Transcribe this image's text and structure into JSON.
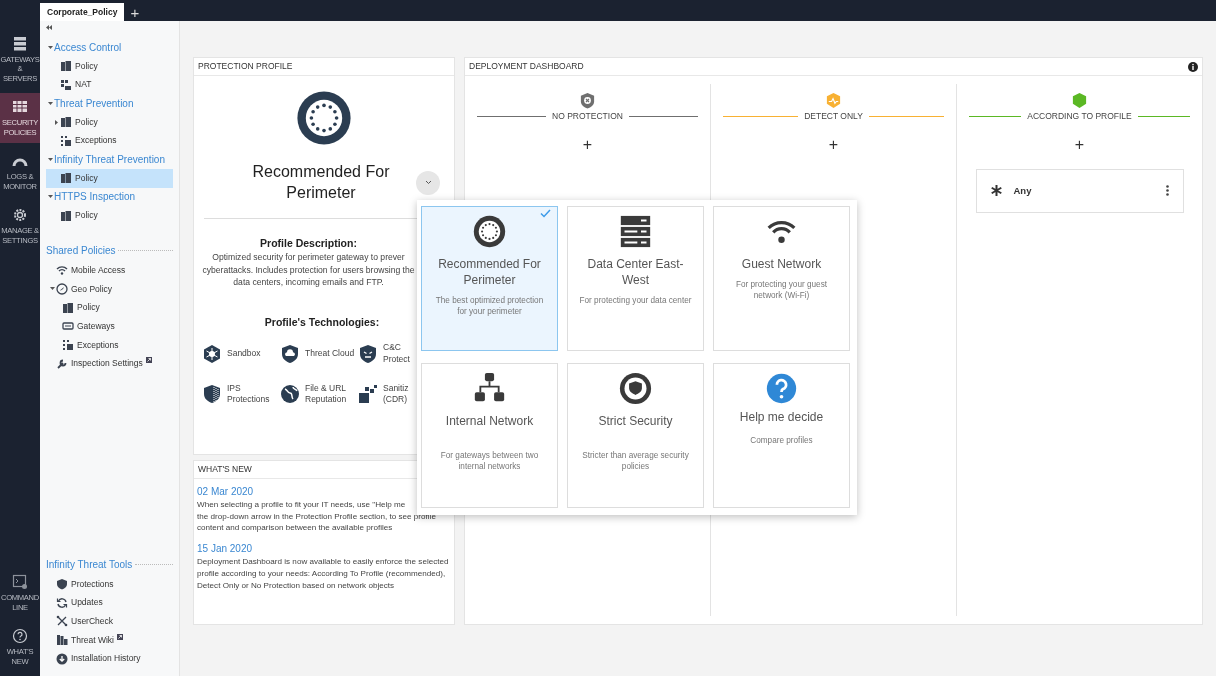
{
  "tabs": [
    {
      "label": "Corporate_Policy",
      "selected": true
    }
  ],
  "new_tab_button": "+",
  "nav": {
    "main": [
      {
        "label": "GATEWAYS & SERVERS",
        "kind": "gateways",
        "selected": false
      },
      {
        "label": "SECURITY POLICIES",
        "kind": "policies",
        "selected": true
      },
      {
        "label": "LOGS & MONITOR",
        "kind": "logs",
        "selected": false
      },
      {
        "label": "MANAGE & SETTINGS",
        "kind": "manage",
        "selected": false
      }
    ],
    "bottom": [
      {
        "label": "COMMAND LINE",
        "kind": "command",
        "selected": false
      },
      {
        "label": "WHAT'S NEW",
        "kind": "whatsnew",
        "selected": false
      }
    ]
  },
  "tree": {
    "sections": [
      {
        "title": "Access Control",
        "expanded": true,
        "children": [
          {
            "label": "Policy",
            "kind": "policy",
            "selected": false
          },
          {
            "label": "NAT",
            "kind": "nat",
            "selected": false
          }
        ]
      },
      {
        "title": "Threat Prevention",
        "expanded": true,
        "children": [
          {
            "label": "Policy",
            "kind": "policy",
            "selected": false,
            "expanded": false
          },
          {
            "label": "Exceptions",
            "kind": "exceptions",
            "selected": false
          }
        ]
      },
      {
        "title": "Infinity Threat Prevention",
        "expanded": true,
        "children": [
          {
            "label": "Policy",
            "kind": "policy",
            "selected": true
          }
        ]
      },
      {
        "title": "HTTPS Inspection",
        "expanded": true,
        "children": [
          {
            "label": "Policy",
            "kind": "policy",
            "selected": false
          }
        ]
      }
    ],
    "groups": [
      {
        "heading": "Shared Policies",
        "items": [
          {
            "label": "Mobile Access",
            "kind": "wifi"
          },
          {
            "label": "Geo Policy",
            "kind": "geo",
            "expanded": true,
            "children": [
              {
                "label": "Policy",
                "kind": "policy"
              },
              {
                "label": "Gateways",
                "kind": "gateways"
              },
              {
                "label": "Exceptions",
                "kind": "exceptions"
              }
            ]
          },
          {
            "label": "Inspection Settings",
            "kind": "wrench",
            "external": true
          }
        ]
      },
      {
        "heading": "Infinity Threat Tools",
        "items": [
          {
            "label": "Protections",
            "kind": "shield"
          },
          {
            "label": "Updates",
            "kind": "updates"
          },
          {
            "label": "UserCheck",
            "kind": "usercheck"
          },
          {
            "label": "Threat Wiki",
            "kind": "wiki",
            "external": true
          },
          {
            "label": "Installation History",
            "kind": "install"
          }
        ]
      }
    ]
  },
  "protection_profile": {
    "header": "PROTECTION PROFILE",
    "name": "Recommended For Perimeter",
    "description_title": "Profile Description:",
    "description_lines": [
      "Optimized security for perimeter gateway to prever",
      "cyberattacks. Includes protection for users browsing the",
      "data centers, incoming emails and FTP."
    ],
    "technologies_title": "Profile's Technologies:",
    "technologies": [
      {
        "label": "Sandbox",
        "kind": "sandbox"
      },
      {
        "label": "Threat Cloud",
        "kind": "cloud"
      },
      {
        "label": "C&C Protect",
        "kind": "cc"
      },
      {
        "label": "IPS Protections",
        "kind": "ips"
      },
      {
        "label": "File & URL Reputation",
        "kind": "globe"
      },
      {
        "label": "Sanitiz (CDR)",
        "kind": "cdr"
      }
    ]
  },
  "whats_new": {
    "header": "WHAT'S NEW",
    "items": [
      {
        "date": "02 Mar 2020",
        "lines": [
          "When selecting a profile to fit your IT needs, use \"Help me",
          "the drop-down arrow in the Protection Profile section, to see profile",
          "content and comparison between the available profiles"
        ]
      },
      {
        "date": "15 Jan 2020",
        "lines": [
          "Deployment Dashboard is now available to easily enforce the selected profile according to your needs: According To Profile (recommended), Detect Only or No Protection based on network objects"
        ]
      }
    ]
  },
  "deployment_dashboard": {
    "header": "DEPLOYMENT DASHBOARD",
    "columns": [
      {
        "title": "NO PROTECTION",
        "kind": "none",
        "color": "#6f6f6f",
        "add": "+"
      },
      {
        "title": "DETECT ONLY",
        "kind": "detect",
        "color": "#f8b133",
        "add": "+"
      },
      {
        "title": "ACCORDING TO PROFILE",
        "kind": "profile",
        "color": "#5bb824",
        "add": "+",
        "objects": [
          {
            "name": "Any"
          }
        ]
      }
    ]
  },
  "profile_menu": [
    {
      "title": "Recommended For Perimeter",
      "subtitle": "The best optimized protection for your perimeter",
      "kind": "perimeter",
      "selected": true
    },
    {
      "title": "Data Center East-West",
      "subtitle": "For protecting your data center",
      "kind": "datacenter",
      "selected": false
    },
    {
      "title": "Guest Network",
      "subtitle": "For protecting your guest network (Wi-Fi)",
      "kind": "guest",
      "selected": false
    },
    {
      "title": "Internal Network",
      "subtitle": "For gateways between two internal networks",
      "kind": "internal",
      "selected": false
    },
    {
      "title": "Strict Security",
      "subtitle": "Stricter than average security policies",
      "kind": "strict",
      "selected": false
    },
    {
      "title": "Help me decide",
      "subtitle": "Compare profiles",
      "kind": "help",
      "selected": false
    }
  ]
}
